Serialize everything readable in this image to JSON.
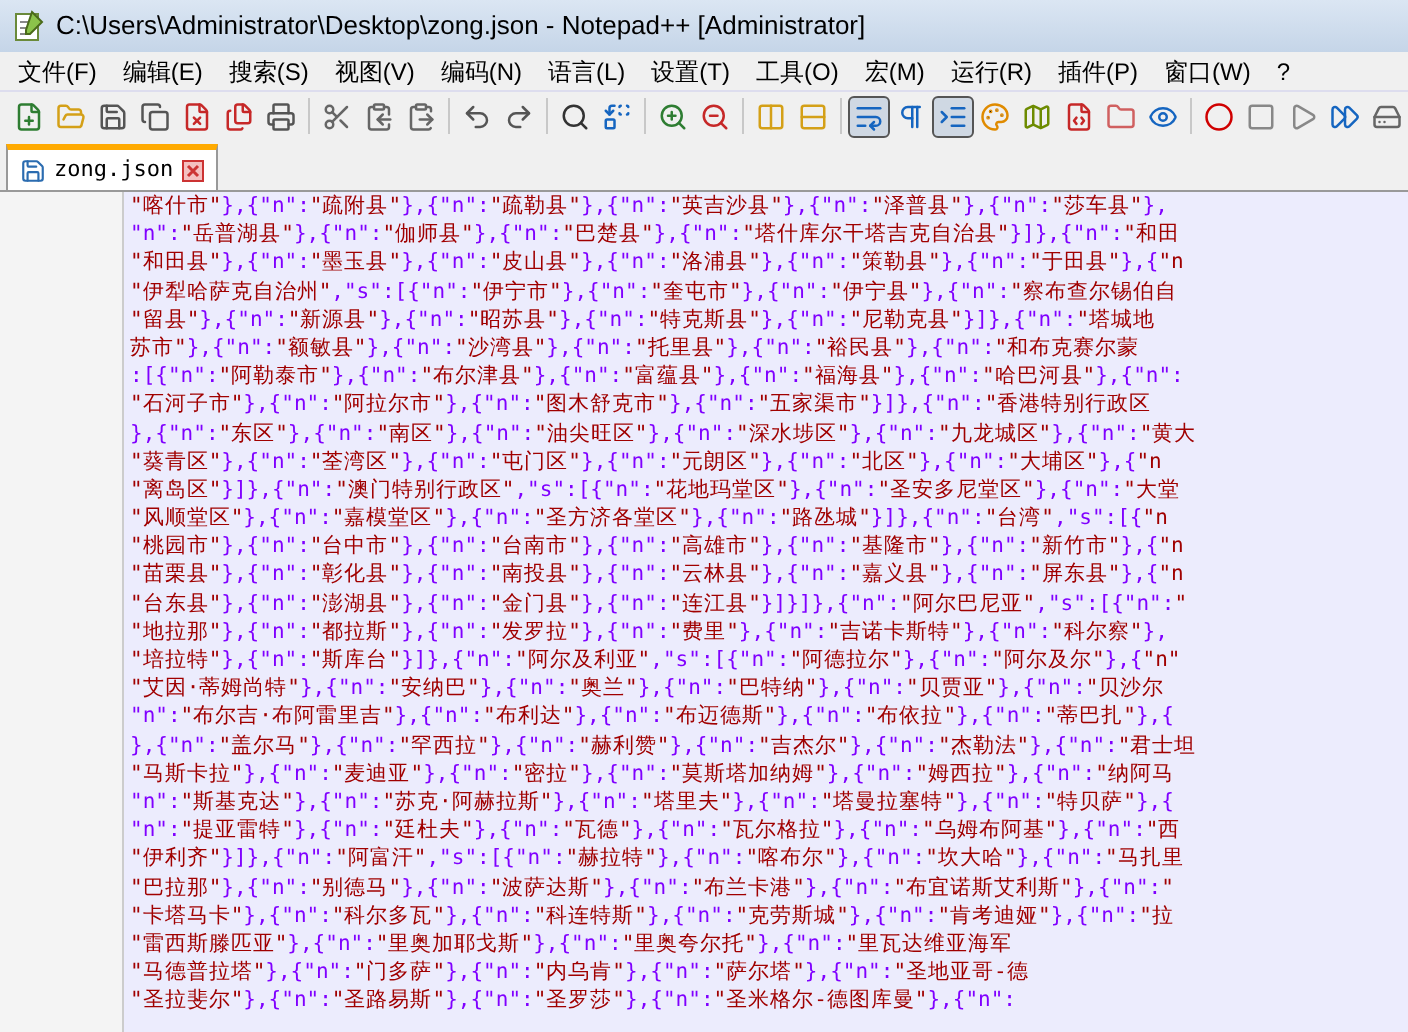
{
  "window": {
    "title": "C:\\Users\\Administrator\\Desktop\\zong.json - Notepad++ [Administrator]"
  },
  "menu": [
    "文件(F)",
    "编辑(E)",
    "搜索(S)",
    "视图(V)",
    "编码(N)",
    "语言(L)",
    "设置(T)",
    "工具(O)",
    "宏(M)",
    "运行(R)",
    "插件(P)",
    "窗口(W)",
    "?"
  ],
  "toolbar": [
    [
      {
        "pressed": false
      },
      {
        "pressed": false
      },
      {
        "pressed": false
      },
      {
        "pressed": false
      },
      {
        "pressed": false
      },
      {
        "pressed": false
      },
      {
        "pressed": false
      }
    ],
    [
      {
        "pressed": false
      },
      {
        "pressed": false
      },
      {
        "pressed": false
      }
    ],
    [
      {
        "pressed": false
      },
      {
        "pressed": false
      }
    ],
    [
      {
        "pressed": false
      },
      {
        "pressed": false
      }
    ],
    [
      {
        "pressed": false
      },
      {
        "pressed": false
      }
    ],
    [
      {
        "pressed": false
      },
      {
        "pressed": false
      }
    ],
    [
      {
        "pressed": true
      },
      {
        "pressed": false
      },
      {
        "pressed": true
      },
      {
        "pressed": false
      },
      {
        "pressed": false
      },
      {
        "pressed": false
      },
      {
        "pressed": false
      },
      {
        "pressed": false
      }
    ],
    [
      {
        "pressed": false
      },
      {
        "pressed": false
      },
      {
        "pressed": false
      },
      {
        "pressed": false
      },
      {
        "pressed": false
      }
    ]
  ],
  "tabs": [
    {
      "label": "zong.json",
      "selected": true
    }
  ],
  "editor": {
    "lines": [
      "\"喀什市\"},{\"n\":\"疏附县\"},{\"n\":\"疏勒县\"},{\"n\":\"英吉沙县\"},{\"n\":\"泽普县\"},{\"n\":\"莎车县\"},",
      "\"n\":\"岳普湖县\"},{\"n\":\"伽师县\"},{\"n\":\"巴楚县\"},{\"n\":\"塔什库尔干塔吉克自治县\"}]},{\"n\":\"和田",
      "\"和田县\"},{\"n\":\"墨玉县\"},{\"n\":\"皮山县\"},{\"n\":\"洛浦县\"},{\"n\":\"策勒县\"},{\"n\":\"于田县\"},{\"n",
      "\"伊犁哈萨克自治州\",\"s\":[{\"n\":\"伊宁市\"},{\"n\":\"奎屯市\"},{\"n\":\"伊宁县\"},{\"n\":\"察布查尔锡伯自",
      "\"留县\"},{\"n\":\"新源县\"},{\"n\":\"昭苏县\"},{\"n\":\"特克斯县\"},{\"n\":\"尼勒克县\"}]},{\"n\":\"塔城地",
      "苏市\"},{\"n\":\"额敏县\"},{\"n\":\"沙湾县\"},{\"n\":\"托里县\"},{\"n\":\"裕民县\"},{\"n\":\"和布克赛尔蒙",
      ":[{\"n\":\"阿勒泰市\"},{\"n\":\"布尔津县\"},{\"n\":\"富蕴县\"},{\"n\":\"福海县\"},{\"n\":\"哈巴河县\"},{\"n\":",
      "\"石河子市\"},{\"n\":\"阿拉尔市\"},{\"n\":\"图木舒克市\"},{\"n\":\"五家渠市\"}]},{\"n\":\"香港特别行政区",
      "},{\"n\":\"东区\"},{\"n\":\"南区\"},{\"n\":\"油尖旺区\"},{\"n\":\"深水埗区\"},{\"n\":\"九龙城区\"},{\"n\":\"黄大",
      "\"葵青区\"},{\"n\":\"荃湾区\"},{\"n\":\"屯门区\"},{\"n\":\"元朗区\"},{\"n\":\"北区\"},{\"n\":\"大埔区\"},{\"n",
      "\"离岛区\"}]},{\"n\":\"澳门特别行政区\",\"s\":[{\"n\":\"花地玛堂区\"},{\"n\":\"圣安多尼堂区\"},{\"n\":\"大堂",
      "\"风顺堂区\"},{\"n\":\"嘉模堂区\"},{\"n\":\"圣方济各堂区\"},{\"n\":\"路氹城\"}]},{\"n\":\"台湾\",\"s\":[{\"n",
      "\"桃园市\"},{\"n\":\"台中市\"},{\"n\":\"台南市\"},{\"n\":\"高雄市\"},{\"n\":\"基隆市\"},{\"n\":\"新竹市\"},{\"n",
      "\"苗栗县\"},{\"n\":\"彰化县\"},{\"n\":\"南投县\"},{\"n\":\"云林县\"},{\"n\":\"嘉义县\"},{\"n\":\"屏东县\"},{\"n",
      "\"台东县\"},{\"n\":\"澎湖县\"},{\"n\":\"金门县\"},{\"n\":\"连江县\"}]}]},{\"n\":\"阿尔巴尼亚\",\"s\":[{\"n\":\"",
      "\"地拉那\"},{\"n\":\"都拉斯\"},{\"n\":\"发罗拉\"},{\"n\":\"费里\"},{\"n\":\"吉诺卡斯特\"},{\"n\":\"科尔察\"},",
      "\"培拉特\"},{\"n\":\"斯库台\"}]},{\"n\":\"阿尔及利亚\",\"s\":[{\"n\":\"阿德拉尔\"},{\"n\":\"阿尔及尔\"},{\"n\"",
      "\"艾因·蒂姆尚特\"},{\"n\":\"安纳巴\"},{\"n\":\"奥兰\"},{\"n\":\"巴特纳\"},{\"n\":\"贝贾亚\"},{\"n\":\"贝沙尔",
      "\"n\":\"布尔吉·布阿雷里吉\"},{\"n\":\"布利达\"},{\"n\":\"布迈德斯\"},{\"n\":\"布依拉\"},{\"n\":\"蒂巴扎\"},{",
      "},{\"n\":\"盖尔马\"},{\"n\":\"罕西拉\"},{\"n\":\"赫利赞\"},{\"n\":\"吉杰尔\"},{\"n\":\"杰勒法\"},{\"n\":\"君士坦",
      "\"马斯卡拉\"},{\"n\":\"麦迪亚\"},{\"n\":\"密拉\"},{\"n\":\"莫斯塔加纳姆\"},{\"n\":\"姆西拉\"},{\"n\":\"纳阿马",
      "\"n\":\"斯基克达\"},{\"n\":\"苏克·阿赫拉斯\"},{\"n\":\"塔里夫\"},{\"n\":\"塔曼拉塞特\"},{\"n\":\"特贝萨\"},{",
      "\"n\":\"提亚雷特\"},{\"n\":\"廷杜夫\"},{\"n\":\"瓦德\"},{\"n\":\"瓦尔格拉\"},{\"n\":\"乌姆布阿基\"},{\"n\":\"西",
      "\"伊利齐\"}]},{\"n\":\"阿富汗\",\"s\":[{\"n\":\"赫拉特\"},{\"n\":\"喀布尔\"},{\"n\":\"坎大哈\"},{\"n\":\"马扎里",
      "\"巴拉那\"},{\"n\":\"别德马\"},{\"n\":\"波萨达斯\"},{\"n\":\"布兰卡港\"},{\"n\":\"布宜诺斯艾利斯\"},{\"n\":\"",
      "\"卡塔马卡\"},{\"n\":\"科尔多瓦\"},{\"n\":\"科连特斯\"},{\"n\":\"克劳斯城\"},{\"n\":\"肯考迪娅\"},{\"n\":\"拉",
      "\"雷西斯滕匹亚\"},{\"n\":\"里奥加耶戈斯\"},{\"n\":\"里奥夸尔托\"},{\"n\":\"里瓦达维亚海军",
      "\"马德普拉塔\"},{\"n\":\"门多萨\"},{\"n\":\"内乌肯\"},{\"n\":\"萨尔塔\"},{\"n\":\"圣地亚哥-德",
      "\"圣拉斐尔\"},{\"n\":\"圣路易斯\"},{\"n\":\"圣罗莎\"},{\"n\":\"圣米格尔-德图库曼\"},{\"n\":"
    ]
  }
}
